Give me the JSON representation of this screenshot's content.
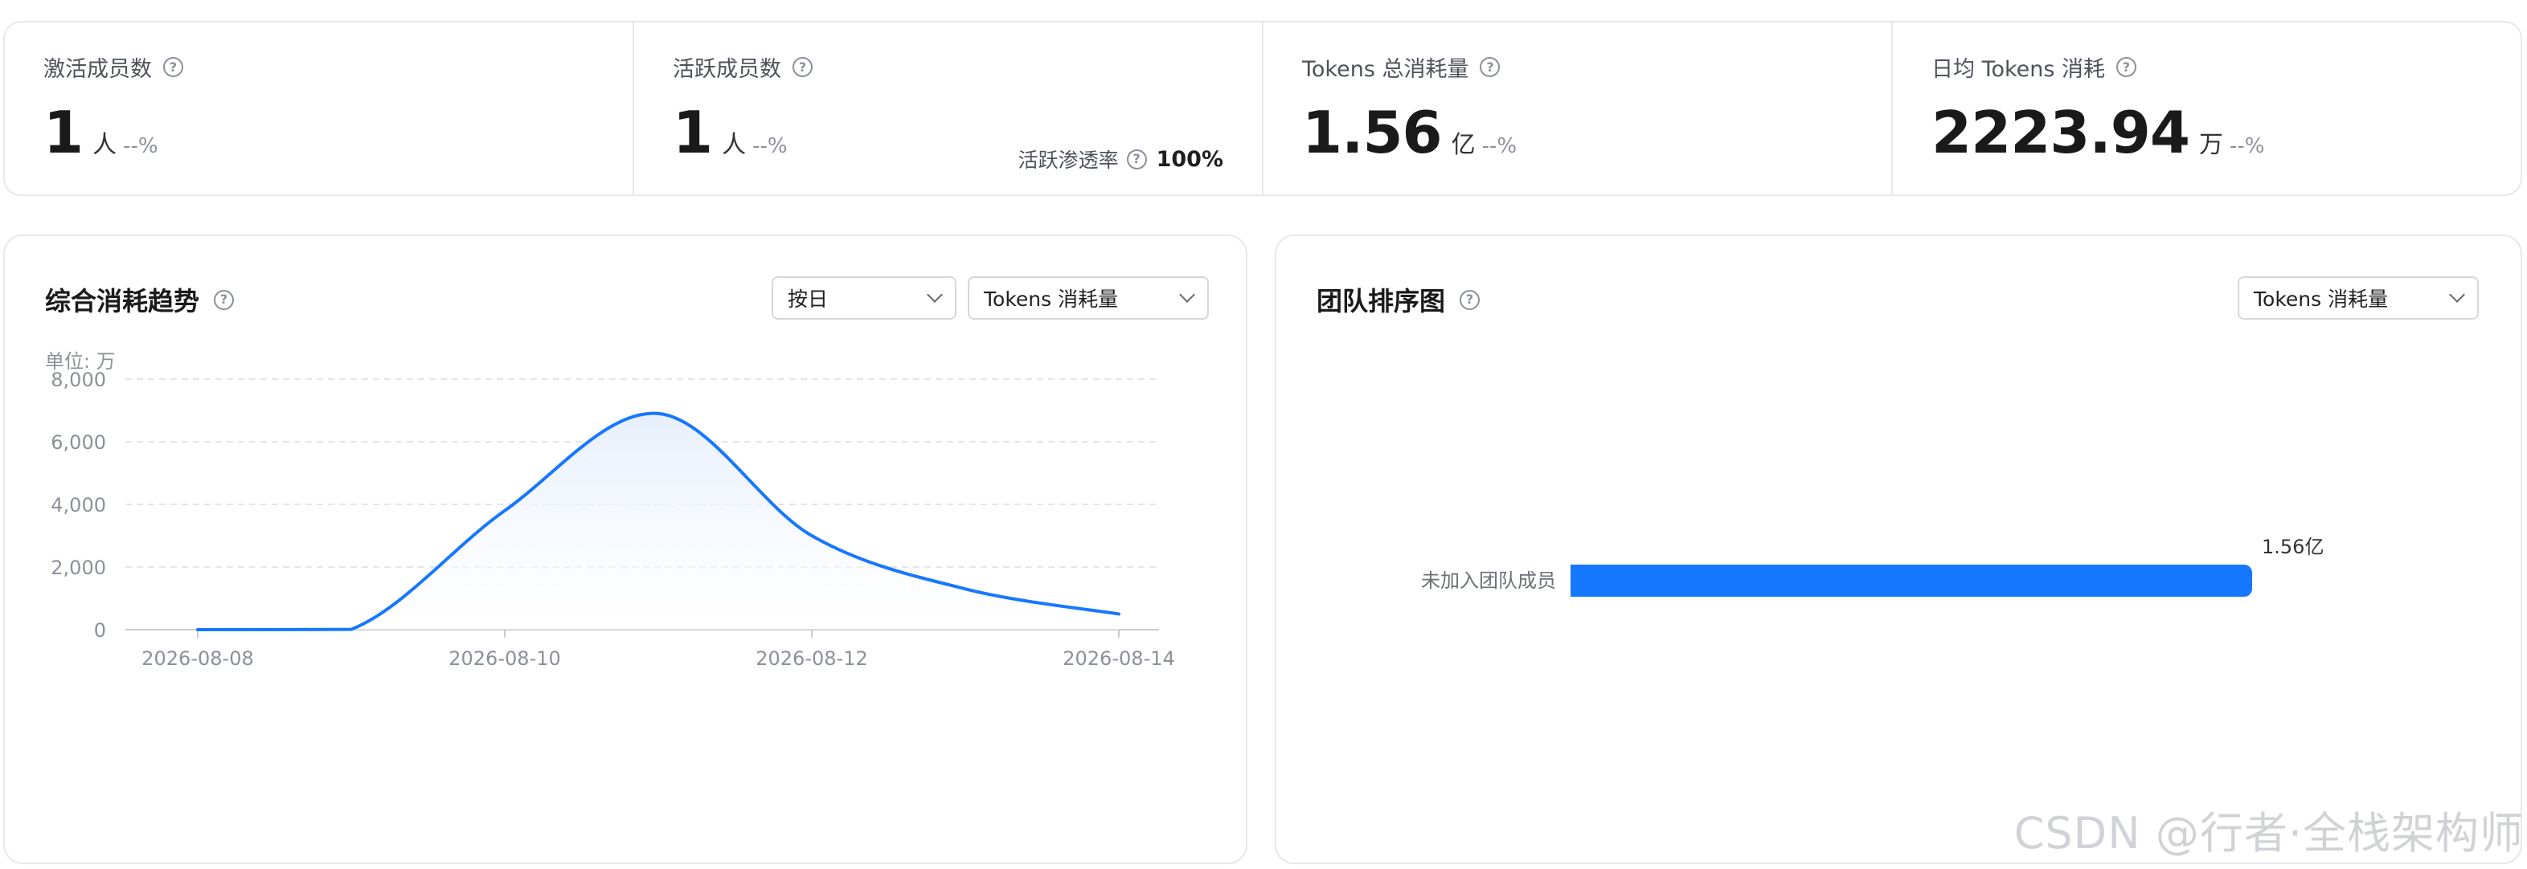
{
  "stats": [
    {
      "label": "激活成员数",
      "value": "1",
      "unit": "人",
      "pct": "--%"
    },
    {
      "label": "活跃成员数",
      "value": "1",
      "unit": "人",
      "pct": "--%",
      "side_label": "活跃渗透率",
      "side_value": "100%"
    },
    {
      "label": "Tokens 总消耗量",
      "value": "1.56",
      "unit": "亿",
      "pct": "--%"
    },
    {
      "label": "日均 Tokens 消耗",
      "value": "2223.94",
      "unit": "万",
      "pct": "--%"
    }
  ],
  "trend": {
    "title": "综合消耗趋势",
    "granularity": "按日",
    "metric": "Tokens 消耗量",
    "unit_label": "单位: 万"
  },
  "ranking": {
    "title": "团队排序图",
    "metric": "Tokens 消耗量"
  },
  "icons": {
    "help": "question-circle-icon",
    "dropdown": "chevron-down-icon"
  },
  "colors": {
    "accent": "#1677ff",
    "grid": "#e3e5e8",
    "area_top": "#e6effc"
  },
  "chart_data": [
    {
      "type": "area",
      "x": [
        "2026-08-08",
        "2026-08-09",
        "2026-08-10",
        "2026-08-11",
        "2026-08-12",
        "2026-08-13",
        "2026-08-14"
      ],
      "x_tick_labels": [
        "2026-08-08",
        "2026-08-10",
        "2026-08-12",
        "2026-08-14"
      ],
      "series": [
        {
          "values": [
            0,
            10,
            3800,
            6900,
            3000,
            1300,
            500
          ]
        }
      ],
      "ylim": [
        0,
        8000
      ],
      "yticks": [
        0,
        2000,
        4000,
        6000,
        8000
      ],
      "ytick_labels": [
        "0",
        "2,000",
        "4,000",
        "6,000",
        "8,000"
      ],
      "grid": true,
      "xlabel": "",
      "ylabel": "单位: 万"
    },
    {
      "type": "bar",
      "orientation": "horizontal",
      "categories": [
        "未加入团队成员"
      ],
      "values": [
        1.56
      ],
      "data_labels": [
        "1.56亿"
      ],
      "value_unit": "亿",
      "grid": false
    }
  ]
}
